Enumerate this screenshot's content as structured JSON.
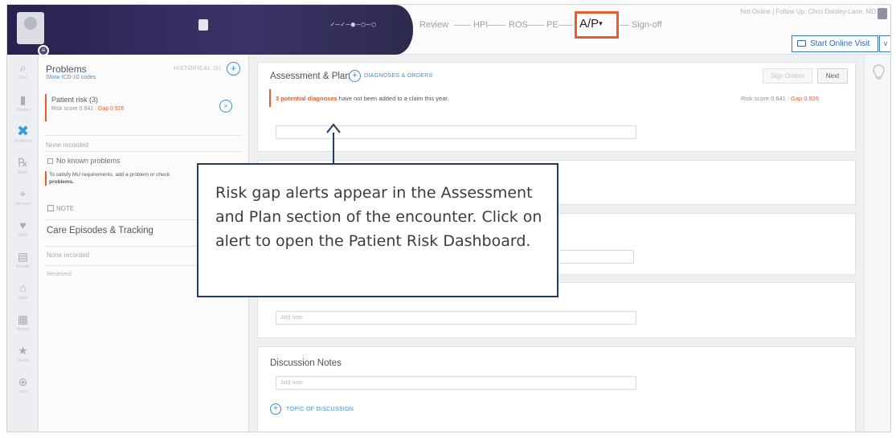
{
  "topbar": {
    "progress_indicator": "✓—✓—●—○—○",
    "steps": [
      "Review",
      "HPI",
      "ROS",
      "PE",
      "A/P",
      "Sign-off"
    ],
    "active_step": "A/P",
    "active_step_caret": "▾",
    "user_line": "Not Online | Follow Up: Chris Daisley-Lane, MD",
    "online_button": "Start Online Visit",
    "online_dropdown": "v",
    "avatar_badge": "≡",
    "accent_color": "#ef5a2a",
    "brand_dark": "#2f2a57"
  },
  "rail": {
    "items": [
      {
        "icon": "search-icon",
        "glyph": "⌕",
        "label": "Find"
      },
      {
        "icon": "chart-icon",
        "glyph": "▮",
        "label": "Charges"
      },
      {
        "icon": "problems-icon",
        "glyph": "✖",
        "label": "Problems",
        "active": true
      },
      {
        "icon": "meds-icon",
        "glyph": "℞",
        "label": "Meds"
      },
      {
        "icon": "vaccines-icon",
        "glyph": "⌖",
        "label": "Vaccines"
      },
      {
        "icon": "vitals-icon",
        "glyph": "♥",
        "label": "Vitals"
      },
      {
        "icon": "results-icon",
        "glyph": "▤",
        "label": "Results"
      },
      {
        "icon": "visits-icon",
        "glyph": "⌂",
        "label": "Visits"
      },
      {
        "icon": "history-icon",
        "glyph": "▦",
        "label": "History"
      },
      {
        "icon": "quality-icon",
        "glyph": "★",
        "label": "Quality"
      },
      {
        "icon": "flow-icon",
        "glyph": "⊕",
        "label": "Flow"
      }
    ]
  },
  "problems": {
    "title": "Problems",
    "show_codes": "Show ICD-10 codes",
    "historical": "HISTORICAL (0)",
    "add": "+",
    "risk_label": "Patient risk (3)",
    "risk_score": "Risk score 0.641",
    "risk_sep": "|",
    "risk_gap": "Gap 0.926",
    "risk_circle": "»",
    "none_recorded": "None recorded",
    "no_known": "No known problems",
    "mu_text": "To satisfy MU requirements, add a problem or check",
    "mu_bold": "problems.",
    "note": "NOTE",
    "care_title": "Care Episodes & Tracking",
    "care_none": "None recorded",
    "reviewed": "Reviewed"
  },
  "assessment": {
    "title": "Assessment & Plan",
    "add": "+",
    "diag_link": "DIAGNOSES & ORDERS",
    "sign_orders": "Sign Orders",
    "next": "Next",
    "alert_link": "3 potential diagnoses",
    "alert_rest": " have not been added to a claim this year.",
    "risk_score": "Risk score 0.641",
    "risk_sep": "|",
    "risk_gap": "Gap 0.926"
  },
  "sections": {
    "blank_note_placeholder": "Add note",
    "discussion_title": "Discussion Notes",
    "discussion_placeholder": "Add note",
    "topic_add": "+",
    "topic_link": "TOPIC OF DISCUSSION"
  },
  "callout": {
    "text": "Risk gap alerts appear in the Assessment and Plan section of the encounter. Click on alert to open the Patient Risk Dashboard."
  }
}
